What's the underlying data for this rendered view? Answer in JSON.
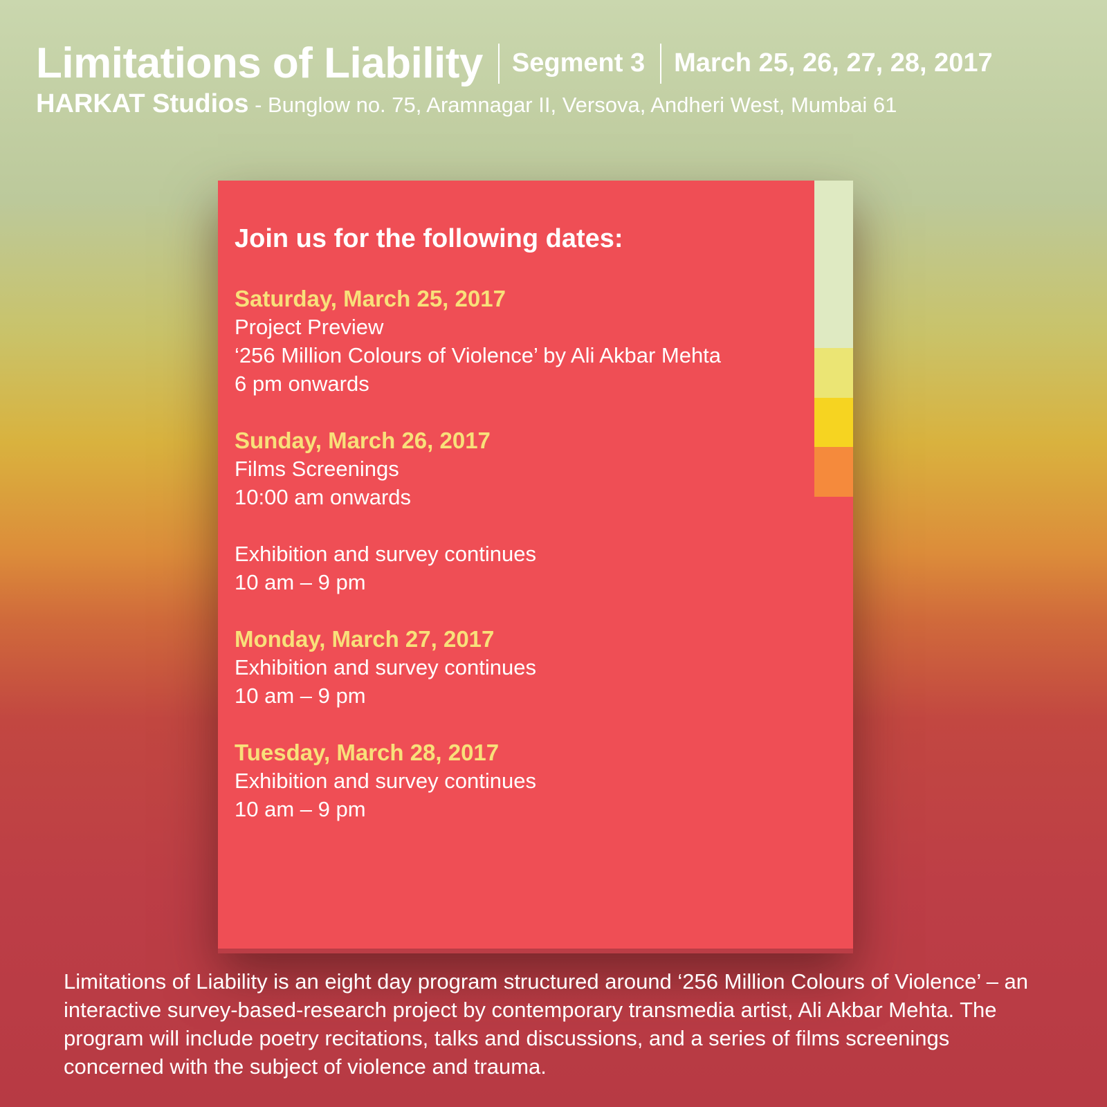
{
  "header": {
    "title": "Limitations of Liability",
    "segment": "Segment 3",
    "dates": "March 25, 26, 27, 28, 2017",
    "studio": "HARKAT Studios",
    "address": " - Bunglow no. 75, Aramnagar II, Versova, Andheri West, Mumbai 61"
  },
  "card": {
    "heading": "Join us for the following dates:",
    "days": [
      {
        "date": "Saturday, March 25, 2017",
        "lines": [
          "Project Preview",
          "‘256 Million Colours of Violence’ by Ali Akbar Mehta",
          "6 pm onwards"
        ]
      },
      {
        "date": "Sunday, March 26, 2017",
        "lines": [
          "Films Screenings",
          "10:00 am onwards"
        ]
      },
      {
        "date": "",
        "lines": [
          "Exhibition and survey continues",
          "10 am – 9 pm"
        ]
      },
      {
        "date": "Monday, March 27, 2017",
        "lines": [
          "Exhibition and survey continues",
          "10 am – 9 pm"
        ]
      },
      {
        "date": "Tuesday, March 28, 2017",
        "lines": [
          "Exhibition and survey continues",
          "10 am – 9 pm"
        ]
      }
    ]
  },
  "footer": {
    "description": "Limitations of Liability is an eight day program structured around ‘256 Million Colours of Violence’ – an interactive survey-based-research project by contemporary transmedia artist, Ali Akbar Mehta. The program will include poetry recitations, talks and discussions, and a series of films screenings concerned with the subject of violence and trauma."
  },
  "colors": {
    "card": "#ef4e55",
    "date_text": "#f8e07a",
    "swatches": [
      "#dfeac2",
      "#ebe574",
      "#f6d421",
      "#f58a3c"
    ]
  }
}
